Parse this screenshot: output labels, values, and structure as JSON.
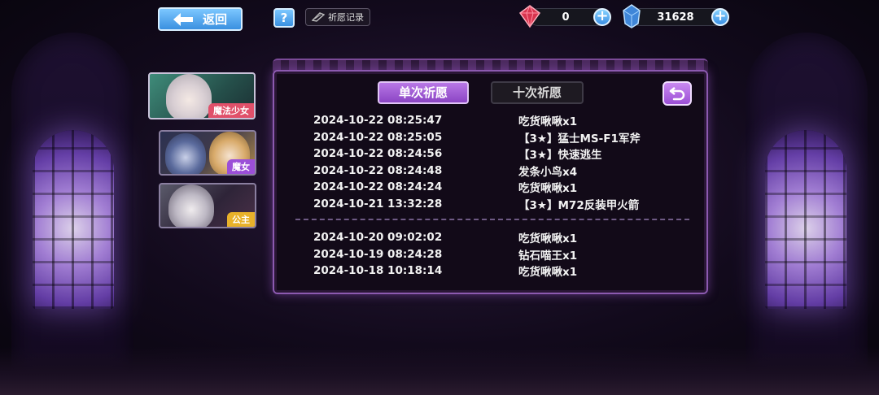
{
  "header": {
    "back_label": "返回",
    "help_label": "?",
    "record_label": "祈愿记录"
  },
  "currencies": {
    "ruby": {
      "icon": "ruby-gem-icon",
      "value": "0",
      "color": "#e0405a"
    },
    "crystal": {
      "icon": "blue-crystal-icon",
      "value": "31628",
      "color": "#4aa0f0"
    }
  },
  "banners": [
    {
      "label": "魔法少女",
      "color": "#e0506a"
    },
    {
      "label": "魔女",
      "color": "#9b4fd8"
    },
    {
      "label": "公主",
      "color": "#e8b12a"
    }
  ],
  "panel": {
    "tabs": {
      "single": "单次祈愿",
      "ten": "十次祈愿",
      "active": "single"
    },
    "records_recent": [
      {
        "time": "2024-10-22 08:25:47",
        "item": "吃货啾啾x1"
      },
      {
        "time": "2024-10-22 08:25:05",
        "item": "【3★】猛士MS-F1军斧"
      },
      {
        "time": "2024-10-22 08:24:56",
        "item": "【3★】快速逃生"
      },
      {
        "time": "2024-10-22 08:24:48",
        "item": "发条小鸟x4"
      },
      {
        "time": "2024-10-22 08:24:24",
        "item": "吃货啾啾x1"
      },
      {
        "time": "2024-10-21 13:32:28",
        "item": "【3★】M72反装甲火箭"
      }
    ],
    "records_older": [
      {
        "time": "2024-10-20 09:02:02",
        "item": "吃货啾啾x1"
      },
      {
        "time": "2024-10-19 08:24:28",
        "item": "钻石喵王x1"
      },
      {
        "time": "2024-10-18 10:18:14",
        "item": "吃货啾啾x1"
      }
    ]
  }
}
